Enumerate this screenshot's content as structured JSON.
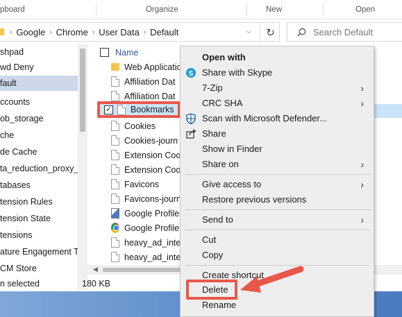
{
  "ribbon": {
    "clipboard": "pboard",
    "organize": "Organize",
    "new": "New",
    "open": "Open"
  },
  "address": {
    "crumbs": [
      "Google",
      "Chrome",
      "User Data",
      "Default"
    ],
    "search_placeholder": "Search Default"
  },
  "nav": {
    "items": [
      "shpad",
      "wd Deny",
      "fault",
      "ccounts",
      "ob_storage",
      "che",
      "de Cache",
      "ta_reduction_proxy_l",
      "tabases",
      "tension Rules",
      "tension State",
      "tensions",
      "ature Engagement Tr",
      "CM Store"
    ],
    "selected_index": 2
  },
  "list": {
    "header_name": "Name",
    "files": [
      {
        "name": "Web Applicatio",
        "icon": "folder-icon"
      },
      {
        "name": "Affiliation Dat",
        "icon": "file-icon"
      },
      {
        "name": "Affiliation Dat",
        "icon": "file-icon"
      },
      {
        "name": "Bookmarks",
        "icon": "file-icon",
        "selected": true
      },
      {
        "name": "Cookies",
        "icon": "file-icon"
      },
      {
        "name": "Cookies-journ",
        "icon": "file-icon"
      },
      {
        "name": "Extension Coo",
        "icon": "file-icon"
      },
      {
        "name": "Extension Coo",
        "icon": "file-icon"
      },
      {
        "name": "Favicons",
        "icon": "file-icon"
      },
      {
        "name": "Favicons-journ",
        "icon": "file-icon"
      },
      {
        "name": "Google Profile",
        "icon": "image-icon"
      },
      {
        "name": "Google Profile",
        "icon": "chrome-icon"
      },
      {
        "name": "heavy_ad_inte",
        "icon": "file-icon"
      },
      {
        "name": "heavy_ad_inte",
        "icon": "file-icon"
      }
    ],
    "right_marks": [
      "2",
      "2",
      "5",
      "5",
      "5",
      "5",
      "2",
      "2",
      "2",
      "2",
      "2",
      "2",
      "2"
    ]
  },
  "status": {
    "selected": "n selected",
    "size": "180 KB"
  },
  "menu": {
    "items": [
      {
        "label": "Open with",
        "bold": true
      },
      {
        "label": "Share with Skype",
        "icon": "skype-icon"
      },
      {
        "label": "7-Zip",
        "submenu": true
      },
      {
        "label": "CRC SHA",
        "submenu": true
      },
      {
        "label": "Scan with Microsoft Defender...",
        "icon": "defender-icon"
      },
      {
        "label": "Share",
        "icon": "share-icon"
      },
      {
        "label": "Show in Finder"
      },
      {
        "label": "Share on",
        "submenu": true
      },
      {
        "label": "Give access to",
        "submenu": true
      },
      {
        "label": "Restore previous versions"
      },
      {
        "label": "Send to",
        "submenu": true
      },
      {
        "label": "Cut"
      },
      {
        "label": "Copy"
      },
      {
        "label": "Create shortcut"
      },
      {
        "label": "Delete"
      },
      {
        "label": "Rename"
      }
    ],
    "arrow_glyph": "›"
  },
  "colors": {
    "highlight": "#e9574a",
    "selection": "#cce4f7",
    "taskbar": "#5a88c9"
  }
}
